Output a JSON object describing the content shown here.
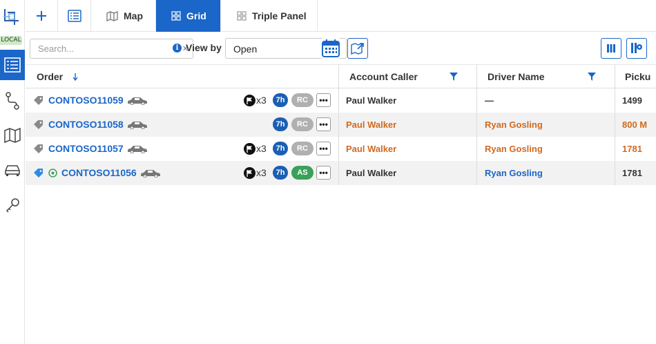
{
  "rail": {
    "badge": "LOCAL",
    "items": [
      {
        "icon": "grid-list-icon",
        "active": true
      },
      {
        "icon": "route-icon",
        "active": false
      },
      {
        "icon": "map-icon",
        "active": false
      },
      {
        "icon": "car-icon",
        "active": false
      },
      {
        "icon": "key-icon",
        "active": false
      }
    ]
  },
  "tabs": {
    "add_icon": "plus-icon",
    "list_icon": "list-icon",
    "items": [
      {
        "label": "Map",
        "icon": "map-icon",
        "active": false
      },
      {
        "label": "Grid",
        "icon": "grid-icon",
        "active": true
      },
      {
        "label": "Triple Panel",
        "icon": "grid-icon",
        "active": false
      }
    ]
  },
  "toolbar": {
    "search_placeholder": "Search...",
    "search_value": "",
    "clear": "×",
    "info": "i",
    "viewby_label": "View by",
    "viewby_value": "Open"
  },
  "grid": {
    "columns": {
      "order": "Order",
      "account_caller": "Account Caller",
      "driver_name": "Driver Name",
      "pickup": "Picku"
    },
    "rows": [
      {
        "tag_color": "#8a8a8a",
        "status_icon": false,
        "order": "CONTOSO11059",
        "flag": true,
        "flag_count": "x3",
        "hours": "7h",
        "status": "RC",
        "status_color": "#b0b0b0",
        "caller": "Paul Walker",
        "caller_color": "dark",
        "driver": "—",
        "driver_color": "dark",
        "pickup": "1499",
        "pickup_color": "dark"
      },
      {
        "tag_color": "#8a8a8a",
        "status_icon": false,
        "order": "CONTOSO11058",
        "flag": false,
        "flag_count": "",
        "hours": "7h",
        "status": "RC",
        "status_color": "#b0b0b0",
        "caller": "Paul Walker",
        "caller_color": "orange",
        "driver": "Ryan Gosling",
        "driver_color": "orange",
        "pickup": "800 M",
        "pickup_color": "orange"
      },
      {
        "tag_color": "#8a8a8a",
        "status_icon": false,
        "order": "CONTOSO11057",
        "flag": true,
        "flag_count": "x3",
        "hours": "7h",
        "status": "RC",
        "status_color": "#b0b0b0",
        "caller": "Paul Walker",
        "caller_color": "orange",
        "driver": "Ryan Gosling",
        "driver_color": "orange",
        "pickup": "1781",
        "pickup_color": "orange"
      },
      {
        "tag_color": "#2f8be0",
        "status_icon": true,
        "order": "CONTOSO11056",
        "flag": true,
        "flag_count": "x3",
        "hours": "7h",
        "status": "AS",
        "status_color": "#3aa15a",
        "caller": "Paul Walker",
        "caller_color": "dark",
        "driver": "Ryan Gosling",
        "driver_color": "link",
        "pickup": "1781",
        "pickup_color": "dark"
      }
    ]
  },
  "colors": {
    "accent": "#1a66c9",
    "orange": "#d2691e"
  }
}
